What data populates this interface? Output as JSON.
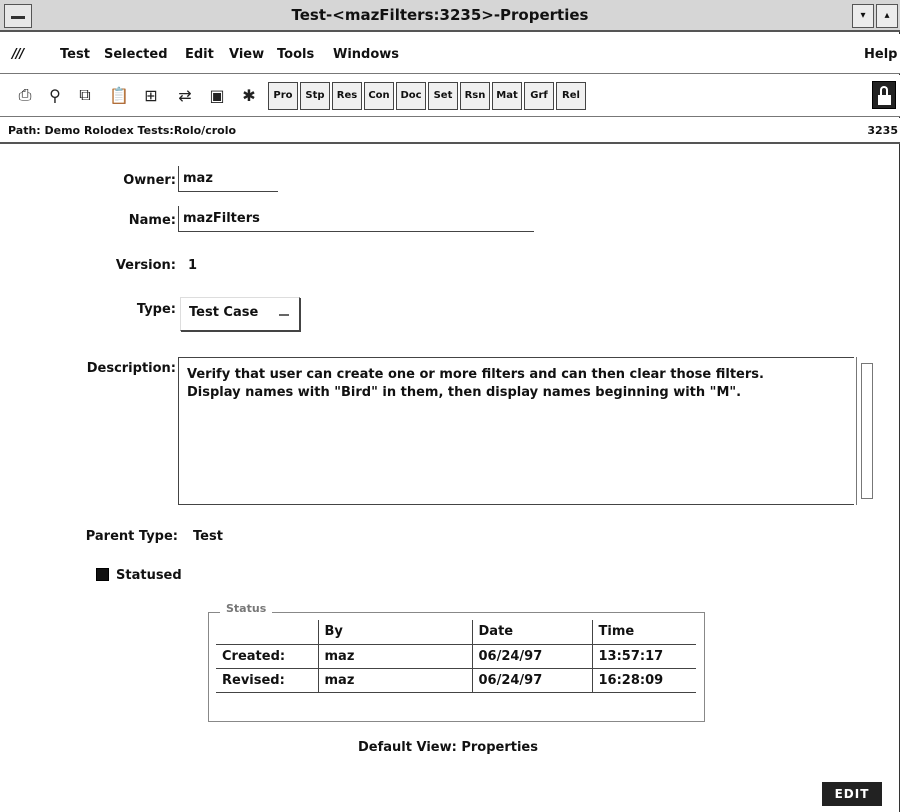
{
  "window": {
    "title": "Test-<mazFilters:3235>-Properties"
  },
  "menubar": {
    "logo": "///",
    "items": [
      {
        "label": "Test"
      },
      {
        "label": "Selected"
      },
      {
        "label": "Edit"
      },
      {
        "label": "View"
      },
      {
        "label": "Tools"
      },
      {
        "label": "Windows"
      }
    ],
    "help": "Help"
  },
  "toolbar": {
    "icons": [
      "print-icon",
      "link-icon",
      "copy-icon",
      "paste-icon",
      "tree-icon",
      "refresh-icon",
      "save-icon",
      "run-icon"
    ],
    "buttons": [
      "Pro",
      "Stp",
      "Res",
      "Con",
      "Doc",
      "Set",
      "Rsn",
      "Mat",
      "Grf",
      "Rel"
    ]
  },
  "pathbar": {
    "path": "Path: Demo Rolodex Tests:Rolo/crolo",
    "id": "3235"
  },
  "form": {
    "owner_label": "Owner:",
    "owner": "maz",
    "name_label": "Name:",
    "name": "mazFilters",
    "version_label": "Version:",
    "version": "1",
    "type_label": "Type:",
    "type": "Test Case",
    "description_label": "Description:",
    "description_line1": "Verify that user can create one or more filters and can then clear those filters.",
    "description_line2": "Display names with \"Bird\" in them, then display names beginning with \"M\".",
    "parent_type_label": "Parent Type:",
    "parent_type": "Test",
    "statused_label": "Statused"
  },
  "status": {
    "title": "Status",
    "columns": [
      "",
      "By",
      "Date",
      "Time"
    ],
    "rows": [
      [
        "Created:",
        "maz",
        "06/24/97",
        "13:57:17"
      ],
      [
        "Revised:",
        "maz",
        "06/24/97",
        "16:28:09"
      ]
    ]
  },
  "footer": {
    "default_view_label": "Default View:",
    "default_view": "Properties",
    "mode": "EDIT"
  }
}
